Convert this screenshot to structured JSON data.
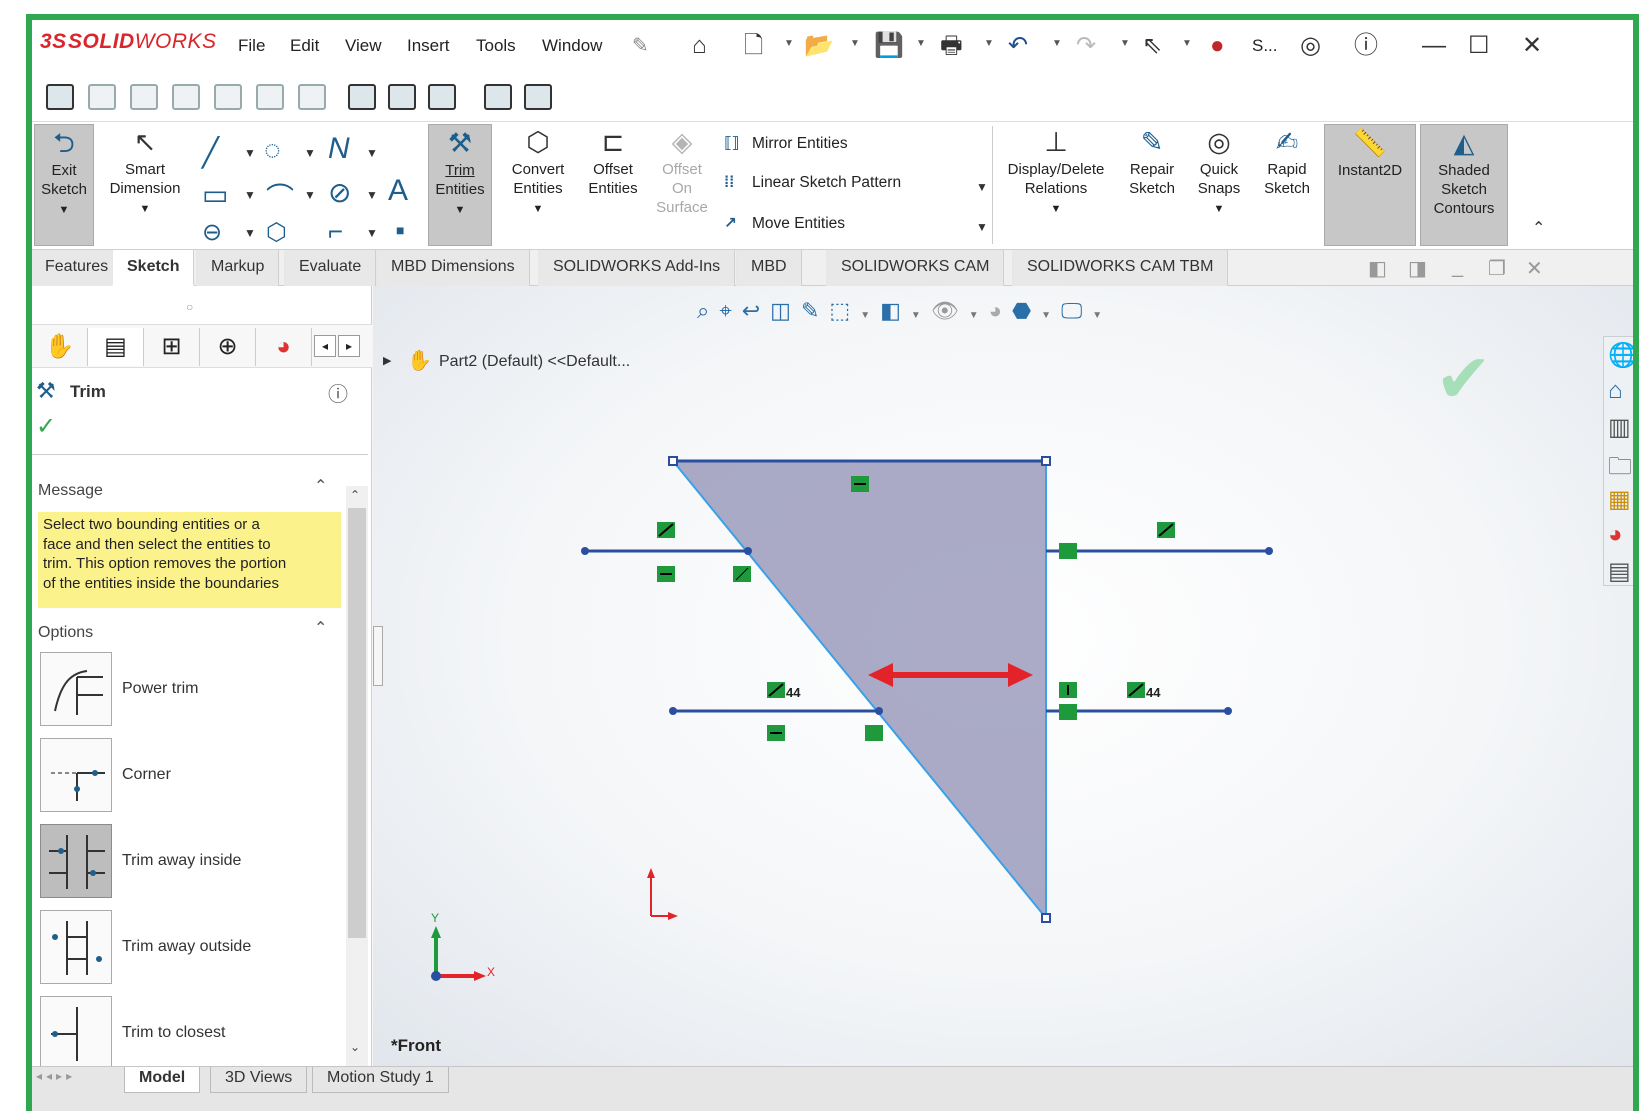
{
  "app": {
    "logo_ds": "3S",
    "logo_solid": "SOLID",
    "logo_works": "WORKS",
    "menu": [
      "File",
      "Edit",
      "View",
      "Insert",
      "Tools",
      "Window"
    ],
    "search_abbrev": "S...",
    "accent_color": "#2fa84f"
  },
  "commands": {
    "exit_sketch": [
      "Exit",
      "Sketch"
    ],
    "smart_dimension": [
      "Smart",
      "Dimension"
    ],
    "trim_entities": [
      "Trim",
      "Entities"
    ],
    "convert_entities": [
      "Convert",
      "Entities"
    ],
    "offset_entities": [
      "Offset",
      "Entities"
    ],
    "offset_on_surface": [
      "Offset",
      "On",
      "Surface"
    ],
    "mirror_entities": "Mirror Entities",
    "linear_sketch_pattern": "Linear Sketch Pattern",
    "move_entities": "Move Entities",
    "display_delete_relations": [
      "Display/Delete",
      "Relations"
    ],
    "repair_sketch": [
      "Repair",
      "Sketch"
    ],
    "quick_snaps": [
      "Quick",
      "Snaps"
    ],
    "rapid_sketch": [
      "Rapid",
      "Sketch"
    ],
    "instant2d": "Instant2D",
    "shaded_sketch_contours": [
      "Shaded",
      "Sketch",
      "Contours"
    ]
  },
  "tabs": [
    "Features",
    "Sketch",
    "Markup",
    "Evaluate",
    "MBD Dimensions",
    "SOLIDWORKS Add-Ins",
    "MBD",
    "SOLIDWORKS CAM",
    "SOLIDWORKS CAM TBM"
  ],
  "active_tab": "Sketch",
  "property_manager": {
    "title": "Trim",
    "message_heading": "Message",
    "message_lines": [
      "Select two bounding entities or a",
      "face and then select the entities to",
      "trim. This option removes the portion",
      "of the entities inside the boundaries"
    ],
    "options_heading": "Options",
    "options": [
      "Power trim",
      "Corner",
      "Trim away inside",
      "Trim away outside",
      "Trim to closest"
    ],
    "selected_option": "Trim away inside"
  },
  "graphics": {
    "tree_label": "Part2 (Default) <<Default...",
    "view_label": "*Front",
    "axis_y": "Y",
    "axis_x": "X",
    "relation_tag": "44"
  },
  "bottom_tabs": [
    "Model",
    "3D Views",
    "Motion Study 1"
  ],
  "active_bottom_tab": "Model"
}
